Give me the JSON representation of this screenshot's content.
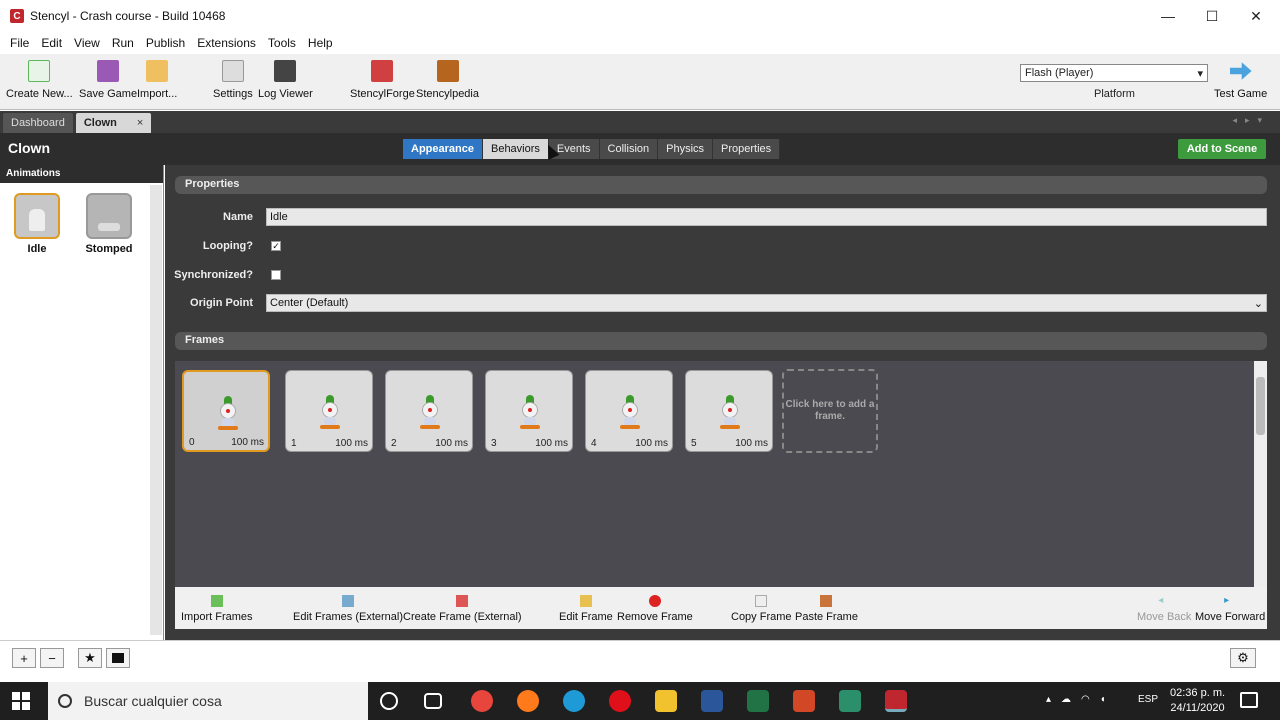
{
  "window": {
    "title": "Stencyl - Crash course - Build 10468"
  },
  "menu": [
    "File",
    "Edit",
    "View",
    "Run",
    "Publish",
    "Extensions",
    "Tools",
    "Help"
  ],
  "toolbar": {
    "create_new": "Create New...",
    "save_game": "Save Game",
    "import": "Import...",
    "settings": "Settings",
    "log_viewer": "Log Viewer",
    "stencylforge": "StencylForge",
    "stencylpedia": "Stencylpedia",
    "platform_value": "Flash (Player)",
    "platform_label": "Platform",
    "test_game": "Test Game"
  },
  "doc_tabs": {
    "dashboard": "Dashboard",
    "clown": "Clown",
    "close": "×"
  },
  "header": {
    "actor_name": "Clown",
    "tabs": [
      "Appearance",
      "Behaviors",
      "Events",
      "Collision",
      "Physics",
      "Properties"
    ],
    "add_to_scene": "Add to Scene"
  },
  "sidebar": {
    "heading": "Animations",
    "items": [
      {
        "label": "Idle"
      },
      {
        "label": "Stomped"
      }
    ]
  },
  "properties": {
    "heading": "Properties",
    "name_label": "Name",
    "name_value": "Idle",
    "looping_label": "Looping?",
    "looping_checked": "✓",
    "sync_label": "Synchronized?",
    "origin_label": "Origin Point",
    "origin_value": "Center (Default)"
  },
  "frames": {
    "heading": "Frames",
    "items": [
      {
        "index": "0",
        "duration": "100 ms"
      },
      {
        "index": "1",
        "duration": "100 ms"
      },
      {
        "index": "2",
        "duration": "100 ms"
      },
      {
        "index": "3",
        "duration": "100 ms"
      },
      {
        "index": "4",
        "duration": "100 ms"
      },
      {
        "index": "5",
        "duration": "100 ms"
      }
    ],
    "add_hint": "Click here to add a frame."
  },
  "frame_tools": {
    "import_frames": "Import Frames",
    "edit_frames_ext": "Edit Frames (External)",
    "create_frame_ext": "Create Frame (External)",
    "edit_frame": "Edit Frame",
    "remove_frame": "Remove Frame",
    "copy_frame": "Copy Frame",
    "paste_frame": "Paste Frame",
    "move_back": "Move Back",
    "move_forward": "Move Forward"
  },
  "statusbar": {
    "add": "+",
    "remove": "−",
    "star": "★"
  },
  "taskbar": {
    "search_placeholder": "Buscar cualquier cosa",
    "lang": "ESP",
    "time": "02:36 p. m.",
    "date": "24/11/2020"
  },
  "colors": {
    "accent_blue": "#2f77c4",
    "add_green": "#3d9b3d",
    "selection_orange": "#e09a20"
  }
}
